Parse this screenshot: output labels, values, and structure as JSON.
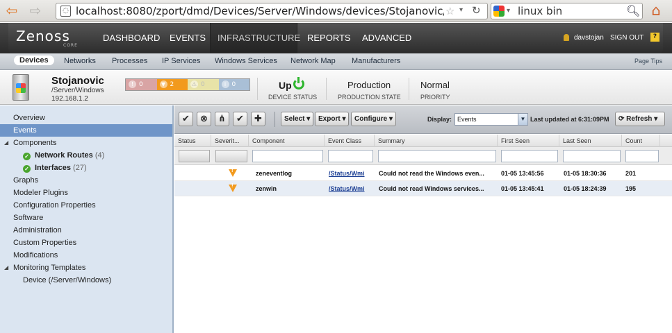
{
  "browser": {
    "url": "localhost:8080/zport/dmd/Devices/Server/Windows/devices/Stojanovic/devic",
    "search_query": "linux bin",
    "back_icon": "back-arrow-icon",
    "forward_icon": "forward-arrow-icon",
    "home_icon": "home-icon"
  },
  "header": {
    "logo": "Zenoss",
    "logo_sub": "CORE",
    "nav": [
      "DASHBOARD",
      "EVENTS",
      "INFRASTRUCTURE",
      "REPORTS",
      "ADVANCED"
    ],
    "active_nav": "INFRASTRUCTURE",
    "user": "davstojan",
    "signout": "SIGN OUT",
    "help": "?"
  },
  "subnav": {
    "items": [
      "Devices",
      "Networks",
      "Processes",
      "IP Services",
      "Windows Services",
      "Network Map",
      "Manufacturers"
    ],
    "active": "Devices",
    "page_tips": "Page Tips"
  },
  "device": {
    "name": "Stojanovic",
    "path": "/Server/Windows",
    "ip": "192.168.1.2",
    "severity_counts": {
      "critical": "0",
      "error": "2",
      "warning": "0",
      "info": "0"
    },
    "status": "Up",
    "status_label": "DEVICE STATUS",
    "production_state": "Production",
    "production_label": "PRODUCTION STATE",
    "priority": "Normal",
    "priority_label": "PRIORITY",
    "accent_colors": {
      "error": "#f29a1e",
      "up": "#2db52d"
    }
  },
  "sidebar": {
    "items": [
      {
        "label": "Overview"
      },
      {
        "label": "Events",
        "selected": true
      },
      {
        "label": "Components"
      },
      {
        "label": "Network Routes",
        "count": "(4)"
      },
      {
        "label": "Interfaces",
        "count": "(27)"
      },
      {
        "label": "Graphs"
      },
      {
        "label": "Modeler Plugins"
      },
      {
        "label": "Configuration Properties"
      },
      {
        "label": "Software"
      },
      {
        "label": "Administration"
      },
      {
        "label": "Custom Properties"
      },
      {
        "label": "Modifications"
      },
      {
        "label": "Monitoring Templates"
      },
      {
        "label": "Device (/Server/Windows)"
      }
    ]
  },
  "toolbar": {
    "select": "Select",
    "export": "Export",
    "configure": "Configure",
    "display_label": "Display:",
    "display_value": "Events",
    "last_updated": "Last updated at 6:31:09PM",
    "refresh": "Refresh"
  },
  "grid": {
    "columns": [
      "Status",
      "Severit...",
      "Component",
      "Event Class",
      "Summary",
      "First Seen",
      "Last Seen",
      "Count"
    ],
    "rows": [
      {
        "severity": "warning",
        "component": "zeneventlog",
        "event_class": "/Status/Wmi",
        "summary": "Could not read the Windows even...",
        "first_seen": "01-05 13:45:56",
        "last_seen": "01-05 18:30:36",
        "count": "201"
      },
      {
        "severity": "warning",
        "component": "zenwin",
        "event_class": "/Status/Wmi",
        "summary": "Could not read Windows services...",
        "first_seen": "01-05 13:45:41",
        "last_seen": "01-05 18:24:39",
        "count": "195"
      }
    ]
  }
}
